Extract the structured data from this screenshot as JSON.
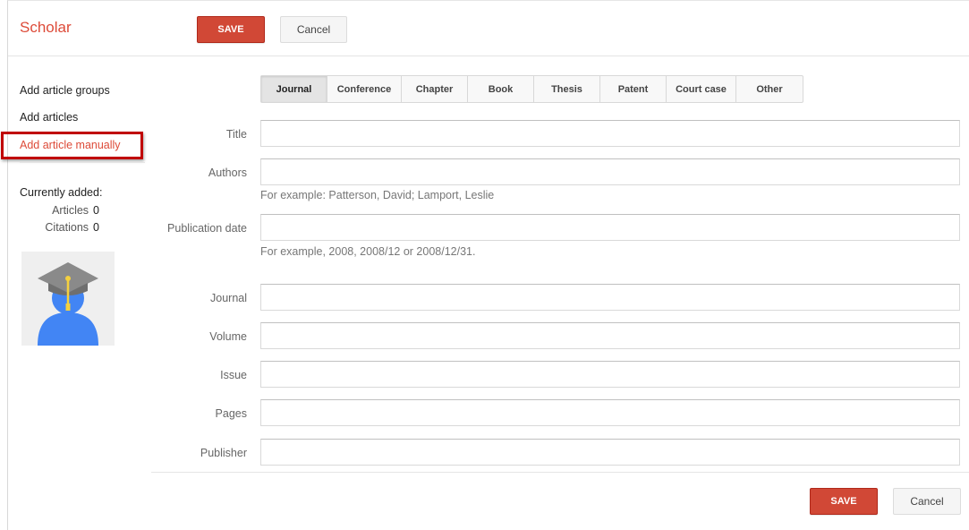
{
  "header": {
    "brand": "Scholar",
    "save_label": "SAVE",
    "cancel_label": "Cancel"
  },
  "sidebar": {
    "links": [
      "Add article groups",
      "Add articles",
      "Add article manually"
    ],
    "active_index": 2,
    "stats_heading": "Currently added:",
    "stats": [
      {
        "label": "Articles",
        "value": "0"
      },
      {
        "label": "Citations",
        "value": "0"
      }
    ]
  },
  "tabs": {
    "items": [
      "Journal",
      "Conference",
      "Chapter",
      "Book",
      "Thesis",
      "Patent",
      "Court case",
      "Other"
    ],
    "selected": "Journal"
  },
  "form": {
    "fields": [
      {
        "label": "Title",
        "value": "",
        "hint": ""
      },
      {
        "label": "Authors",
        "value": "",
        "hint": "For example: Patterson, David; Lamport, Leslie"
      },
      {
        "label": "Publication date",
        "value": "",
        "hint": "For example, 2008, 2008/12 or 2008/12/31."
      },
      {
        "label": "Journal",
        "value": "",
        "hint": ""
      },
      {
        "label": "Volume",
        "value": "",
        "hint": ""
      },
      {
        "label": "Issue",
        "value": "",
        "hint": ""
      },
      {
        "label": "Pages",
        "value": "",
        "hint": ""
      },
      {
        "label": "Publisher",
        "value": "",
        "hint": ""
      }
    ]
  },
  "footer": {
    "save_label": "SAVE",
    "cancel_label": "Cancel"
  },
  "colors": {
    "brand": "#dd4b39",
    "save_button": "#d14836",
    "highlight_box": "#c00000",
    "avatar_body": "#4285f4",
    "avatar_cap": "#8a8a8a",
    "avatar_tassel": "#f4d03f"
  },
  "icons": {
    "avatar": "graduate-avatar-icon"
  }
}
